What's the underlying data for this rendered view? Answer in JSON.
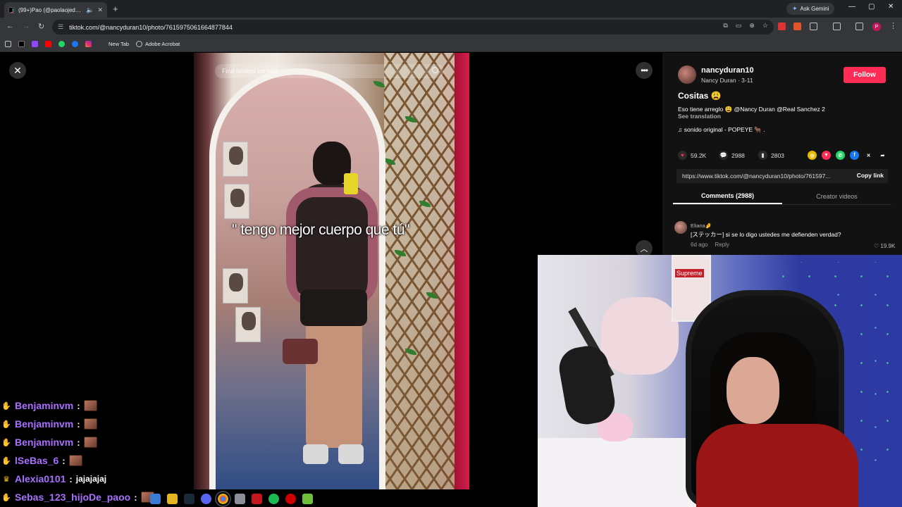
{
  "browser": {
    "tab": {
      "title": "(99+)Pao (@paolaojedda) |"
    },
    "new_tab_symbol": "+",
    "gemini_label": "Ask Gemini",
    "window_controls": [
      "—",
      "▢",
      "✕"
    ],
    "url": "tiktok.com/@nancyduran10/photo/7615975061664877844",
    "bookmarks": [
      {
        "label": "New Tab",
        "icon": "newtab-icon"
      },
      {
        "label": "Adobe Acrobat",
        "icon": "acrobat-icon"
      }
    ],
    "profile_initial": "P"
  },
  "viewer": {
    "search_placeholder": "Find related content",
    "caption": "\" tengo mejor cuerpo que tú\"",
    "close_symbol": "✕",
    "more_symbol": "•••",
    "up_symbol": "︿"
  },
  "post": {
    "username": "nancyduran10",
    "subtitle": "Nancy Duran · 3-11",
    "follow_label": "Follow",
    "title": "Cositas 😩",
    "description": "Eso tiene arreglo 😩 @Nancy Duran @Real Sanchez 2",
    "see_translation": "See translation",
    "music": "♫  sonido original - POPEYE 🐂 .",
    "likes": "59.2K",
    "comments": "2988",
    "saves": "2803",
    "link": "https://www.tiktok.com/@nancyduran10/photo/761597...",
    "copy_label": "Copy link",
    "tabs": [
      "Comments (2988)",
      "Creator videos"
    ],
    "comment": {
      "user": "Eliana🤌",
      "text": "[ステッカー] si se lo digo ustedes me defienden verdad?",
      "age": "6d ago",
      "reply": "Reply",
      "likes": "♡ 19.9K"
    }
  },
  "chat": [
    {
      "user": "Benjaminvm",
      "message": ""
    },
    {
      "user": "Benjaminvm",
      "message": ""
    },
    {
      "user": "Benjaminvm",
      "message": ""
    },
    {
      "user": "lSeBas_6",
      "message": ""
    },
    {
      "user": "Alexia0101",
      "message": "jajajajaj"
    },
    {
      "user": "Sebas_123_hijoDe_paoo",
      "message": ""
    }
  ],
  "colors": {
    "accent": "#fe2c55",
    "chat_user": "#a970ff",
    "panel_bg": "#121212"
  }
}
